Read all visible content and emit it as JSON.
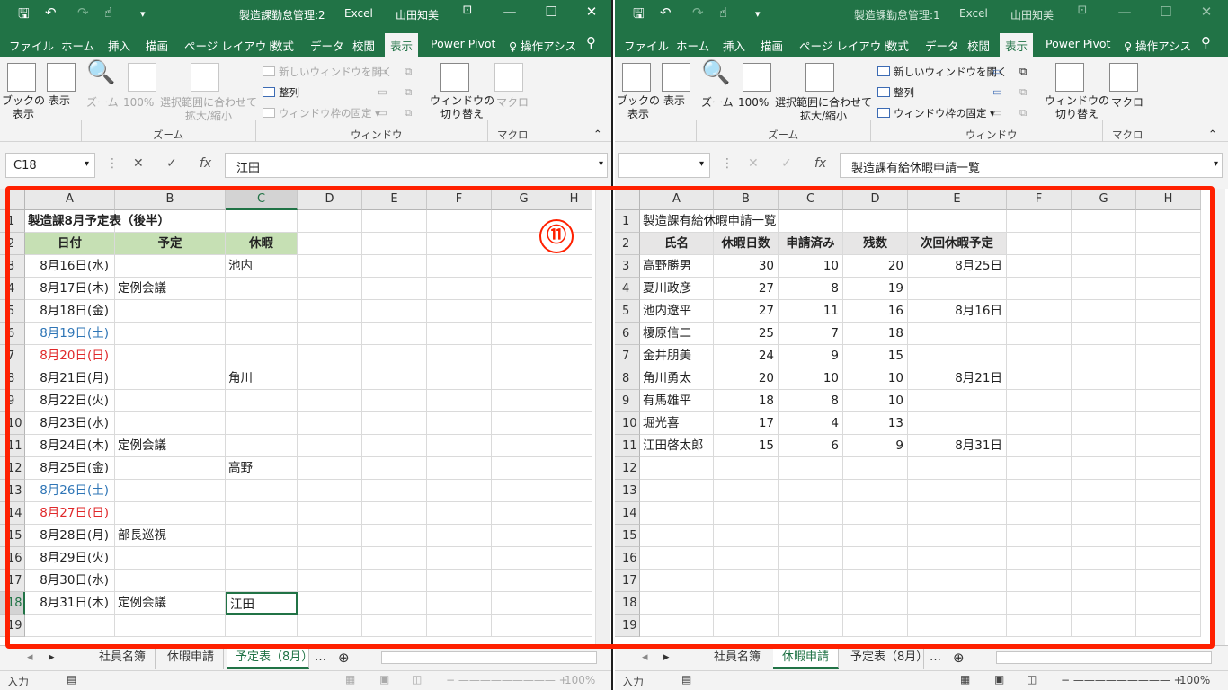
{
  "left": {
    "title": "製造課勤怠管理:2",
    "app": "Excel",
    "user": "山田知美",
    "ribbon_tabs": [
      "ファイル",
      "ホーム",
      "挿入",
      "描画",
      "ページ レイアウト",
      "数式",
      "データ",
      "校閲",
      "表示",
      "Power Pivot",
      "操作アシス"
    ],
    "name_box": "C18",
    "formula": "江田",
    "columns": [
      "A",
      "B",
      "C",
      "D",
      "E",
      "F",
      "G",
      "H"
    ],
    "rows": [
      {
        "n": "1",
        "a": "製造課8月予定表（後半）",
        "b": "",
        "c": ""
      },
      {
        "n": "2",
        "a": "日付",
        "b": "予定",
        "c": "休暇"
      },
      {
        "n": "3",
        "a": "8月16日(水)",
        "b": "",
        "c": "池内"
      },
      {
        "n": "4",
        "a": "8月17日(木)",
        "b": "定例会議",
        "c": ""
      },
      {
        "n": "5",
        "a": "8月18日(金)",
        "b": "",
        "c": ""
      },
      {
        "n": "6",
        "a": "8月19日(土)",
        "b": "",
        "c": "",
        "color": "#2e75b6"
      },
      {
        "n": "7",
        "a": "8月20日(日)",
        "b": "",
        "c": "",
        "color": "#e0282a"
      },
      {
        "n": "8",
        "a": "8月21日(月)",
        "b": "",
        "c": "角川"
      },
      {
        "n": "9",
        "a": "8月22日(火)",
        "b": "",
        "c": ""
      },
      {
        "n": "10",
        "a": "8月23日(水)",
        "b": "",
        "c": ""
      },
      {
        "n": "11",
        "a": "8月24日(木)",
        "b": "定例会議",
        "c": ""
      },
      {
        "n": "12",
        "a": "8月25日(金)",
        "b": "",
        "c": "高野"
      },
      {
        "n": "13",
        "a": "8月26日(土)",
        "b": "",
        "c": "",
        "color": "#2e75b6"
      },
      {
        "n": "14",
        "a": "8月27日(日)",
        "b": "",
        "c": "",
        "color": "#e0282a"
      },
      {
        "n": "15",
        "a": "8月28日(月)",
        "b": "部長巡視",
        "c": ""
      },
      {
        "n": "16",
        "a": "8月29日(火)",
        "b": "",
        "c": ""
      },
      {
        "n": "17",
        "a": "8月30日(水)",
        "b": "",
        "c": ""
      },
      {
        "n": "18",
        "a": "8月31日(木)",
        "b": "定例会議",
        "c": "江田"
      },
      {
        "n": "19",
        "a": "",
        "b": "",
        "c": ""
      }
    ],
    "sheets": [
      "社員名簿",
      "休暇申請",
      "予定表（8月）"
    ],
    "active_sheet": "予定表（8月）",
    "status_mode": "入力",
    "zoom": "100%"
  },
  "right": {
    "title": "製造課勤怠管理:1",
    "app": "Excel",
    "user": "山田知美",
    "ribbon_tabs": [
      "ファイル",
      "ホーム",
      "挿入",
      "描画",
      "ページ レイアウト",
      "数式",
      "データ",
      "校閲",
      "表示",
      "Power Pivot",
      "操作アシス"
    ],
    "name_box": "",
    "formula": "製造課有給休暇申請一覧",
    "columns": [
      "A",
      "B",
      "C",
      "D",
      "E",
      "F",
      "G",
      "H"
    ],
    "header_row": [
      "氏名",
      "休暇日数",
      "申請済み",
      "残数",
      "次回休暇予定"
    ],
    "title_cell": "製造課有給休暇申請一覧",
    "data_rows": [
      [
        "高野勝男",
        "30",
        "10",
        "20",
        "8月25日"
      ],
      [
        "夏川政彦",
        "27",
        "8",
        "19",
        ""
      ],
      [
        "池内遼平",
        "27",
        "11",
        "16",
        "8月16日"
      ],
      [
        "榎原信二",
        "25",
        "7",
        "18",
        ""
      ],
      [
        "金井朋美",
        "24",
        "9",
        "15",
        ""
      ],
      [
        "角川勇太",
        "20",
        "10",
        "10",
        "8月21日"
      ],
      [
        "有馬雄平",
        "18",
        "8",
        "10",
        ""
      ],
      [
        "堀光喜",
        "17",
        "4",
        "13",
        ""
      ],
      [
        "江田啓太郎",
        "15",
        "6",
        "9",
        "8月31日"
      ]
    ],
    "row_numbers": [
      "1",
      "2",
      "3",
      "4",
      "5",
      "6",
      "7",
      "8",
      "9",
      "10",
      "11",
      "12",
      "13",
      "14",
      "15",
      "16",
      "17",
      "18",
      "19"
    ],
    "sheets": [
      "社員名簿",
      "休暇申請",
      "予定表（8月）"
    ],
    "active_sheet": "休暇申請",
    "status_mode": "入力",
    "zoom": "100%"
  },
  "ribbon": {
    "book_view": "ブックの\n表示",
    "show": "表示",
    "zoom": "ズーム",
    "zoom100": "100%",
    "zoom_sel": "選択範囲に合わせて\n拡大/縮小",
    "new_window": "新しいウィンドウを開く",
    "arrange": "整列",
    "freeze": "ウィンドウ枠の固定",
    "switch_window": "ウィンドウの\n切り替え",
    "macro": "マクロ",
    "grp_zoom": "ズーム",
    "grp_window": "ウィンドウ",
    "grp_macro": "マクロ"
  },
  "badge": "⑪",
  "colors": {
    "excel_green": "#217346",
    "header_fill": "#c6e0b4",
    "annotation_red": "#ff2000"
  }
}
